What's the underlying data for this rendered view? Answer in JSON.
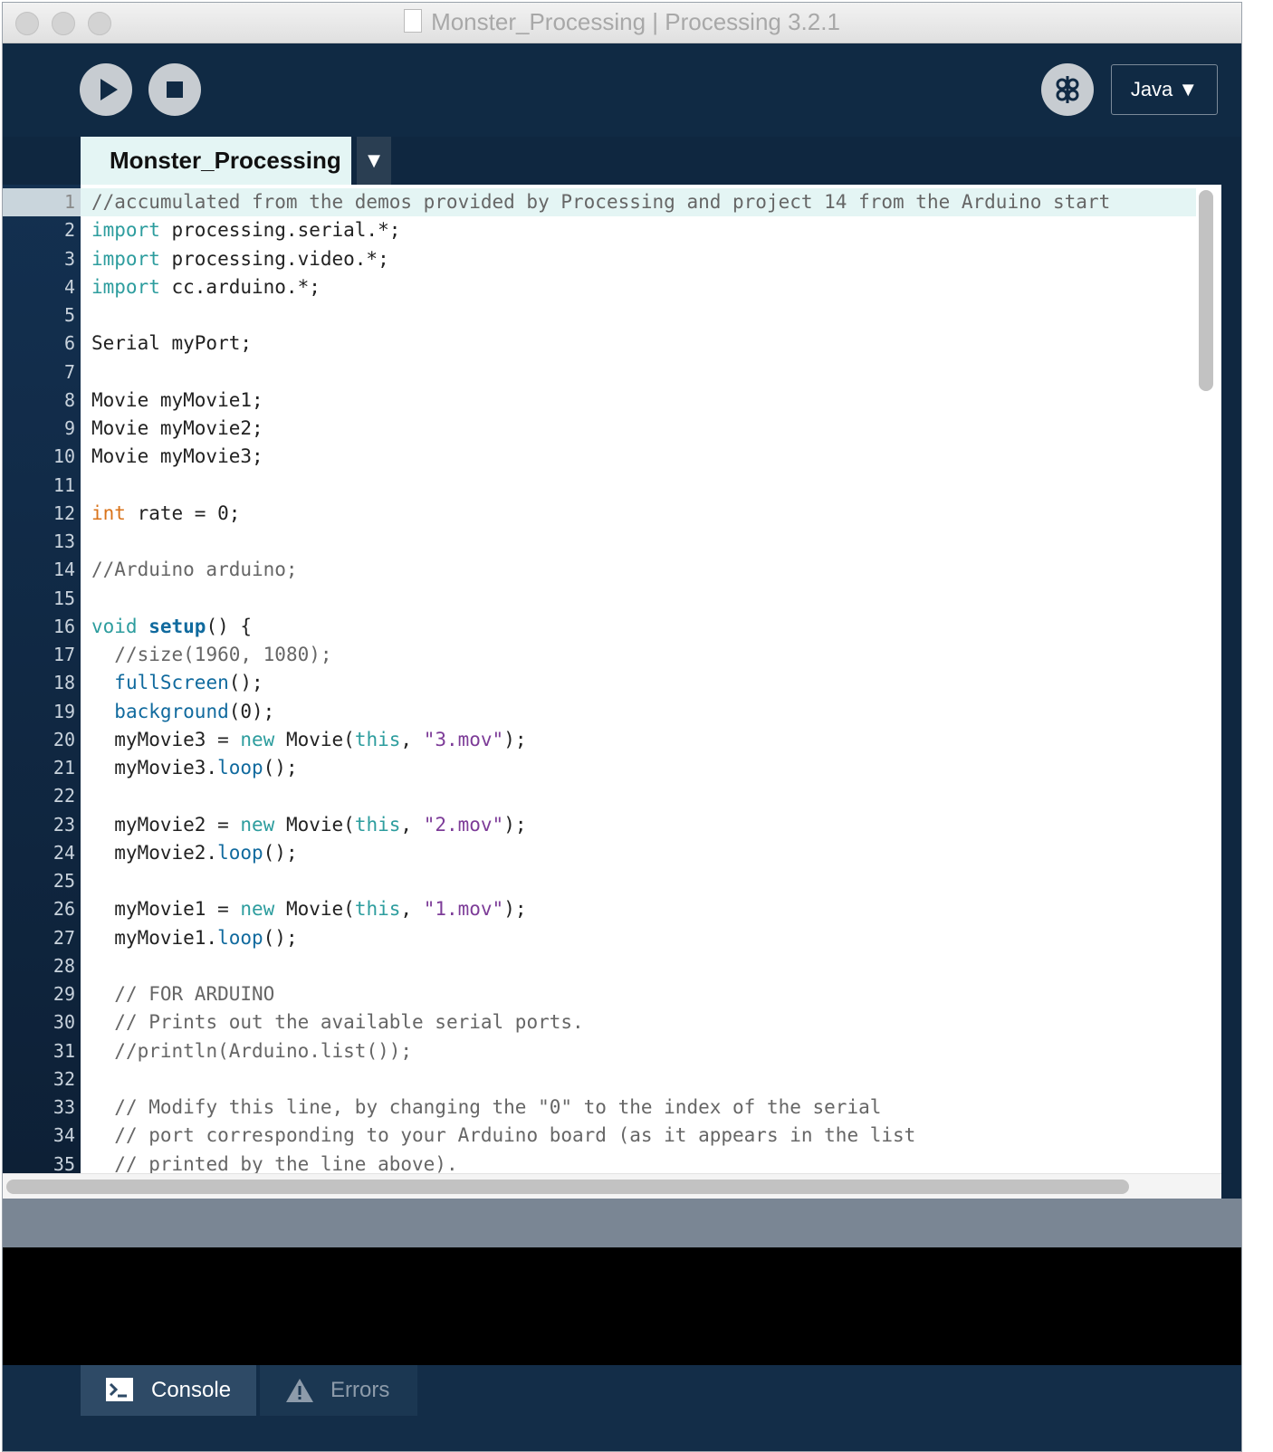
{
  "window": {
    "title": "Monster_Processing | Processing 3.2.1"
  },
  "toolbar": {
    "run_icon": "play-icon",
    "stop_icon": "stop-icon",
    "debugger_icon": "debugger-icon",
    "mode_label": "Java ▼"
  },
  "tabs": [
    {
      "label": "Monster_Processing",
      "active": true
    }
  ],
  "tab_menu_label": "▼",
  "editor": {
    "current_line": 1,
    "lines": [
      {
        "n": "1",
        "html": "<span class=\"c\">//accumulated from the demos provided by Processing and project 14 from the Arduino start</span>"
      },
      {
        "n": "2",
        "html": "<span class=\"k\">import</span> processing.serial.*;"
      },
      {
        "n": "3",
        "html": "<span class=\"k\">import</span> processing.video.*;"
      },
      {
        "n": "4",
        "html": "<span class=\"k\">import</span> cc.arduino.*;"
      },
      {
        "n": "5",
        "html": ""
      },
      {
        "n": "6",
        "html": "Serial myPort;"
      },
      {
        "n": "7",
        "html": ""
      },
      {
        "n": "8",
        "html": "Movie myMovie1;"
      },
      {
        "n": "9",
        "html": "Movie myMovie2;"
      },
      {
        "n": "10",
        "html": "Movie myMovie3;"
      },
      {
        "n": "11",
        "html": ""
      },
      {
        "n": "12",
        "html": "<span class=\"o\">int</span> rate = 0;"
      },
      {
        "n": "13",
        "html": ""
      },
      {
        "n": "14",
        "html": "<span class=\"c\">//Arduino arduino;</span>"
      },
      {
        "n": "15",
        "html": ""
      },
      {
        "n": "16",
        "html": "<span class=\"k\">void</span> <span class=\"fb\">setup</span>() {"
      },
      {
        "n": "17",
        "html": "  <span class=\"c\">//size(1960, 1080);</span>"
      },
      {
        "n": "18",
        "html": "  <span class=\"f\">fullScreen</span>();"
      },
      {
        "n": "19",
        "html": "  <span class=\"f\">background</span>(0);"
      },
      {
        "n": "20",
        "html": "  myMovie3 = <span class=\"k\">new</span> Movie(<span class=\"k\">this</span>, <span class=\"s\">\"3.mov\"</span>);"
      },
      {
        "n": "21",
        "html": "  myMovie3.<span class=\"f\">loop</span>();"
      },
      {
        "n": "22",
        "html": ""
      },
      {
        "n": "23",
        "html": "  myMovie2 = <span class=\"k\">new</span> Movie(<span class=\"k\">this</span>, <span class=\"s\">\"2.mov\"</span>);"
      },
      {
        "n": "24",
        "html": "  myMovie2.<span class=\"f\">loop</span>();"
      },
      {
        "n": "25",
        "html": ""
      },
      {
        "n": "26",
        "html": "  myMovie1 = <span class=\"k\">new</span> Movie(<span class=\"k\">this</span>, <span class=\"s\">\"1.mov\"</span>);"
      },
      {
        "n": "27",
        "html": "  myMovie1.<span class=\"f\">loop</span>();"
      },
      {
        "n": "28",
        "html": ""
      },
      {
        "n": "29",
        "html": "  <span class=\"c\">// FOR ARDUINO</span>"
      },
      {
        "n": "30",
        "html": "  <span class=\"c\">// Prints out the available serial ports.</span>"
      },
      {
        "n": "31",
        "html": "  <span class=\"c\">//println(Arduino.list());</span>"
      },
      {
        "n": "32",
        "html": ""
      },
      {
        "n": "33",
        "html": "  <span class=\"c\">// Modify this line, by changing the \"0\" to the index of the serial</span>"
      },
      {
        "n": "34",
        "html": "  <span class=\"c\">// port corresponding to your Arduino board (as it appears in the list</span>"
      },
      {
        "n": "35",
        "html": "  <span class=\"c\">// printed by the line above).</span>"
      }
    ]
  },
  "footer": {
    "console_label": "Console",
    "errors_label": "Errors",
    "console_icon": "terminal-icon",
    "errors_icon": "warning-icon"
  },
  "colors": {
    "toolbar_bg": "#102a44",
    "tab_active_bg": "#e4f5f4",
    "keyword": "#2d9d9e",
    "type_int": "#d9731a",
    "function": "#106a9e",
    "string": "#7d3c98",
    "comment": "#666666"
  }
}
